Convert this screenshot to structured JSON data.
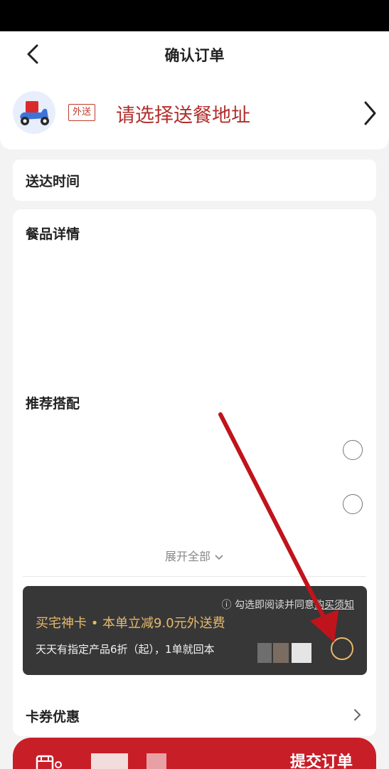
{
  "header": {
    "title": "确认订单"
  },
  "address": {
    "tag": "外送",
    "prompt": "请选择送餐地址"
  },
  "delivery_time": {
    "label": "送达时间"
  },
  "details": {
    "label": "餐品详情",
    "recommend_label": "推荐搭配",
    "expand_label": "展开全部"
  },
  "member_card": {
    "notice_prefix": "ⓘ 勾选即阅读并同意",
    "notice_link": "购买须知",
    "headline": "买宅神卡 • 本单立减9.0元外送费",
    "sub": "天天有指定产品6折（起），1单就回本"
  },
  "coupon": {
    "label": "卡券优惠"
  },
  "submit": {
    "label": "提交订单"
  },
  "colors": {
    "brand_red": "#c81e28",
    "gold": "#e7b86a",
    "annotation_arrow": "#c0141c"
  },
  "icons": [
    "back-arrow-icon",
    "scooter-icon",
    "chevron-right-icon",
    "cart-icon"
  ]
}
